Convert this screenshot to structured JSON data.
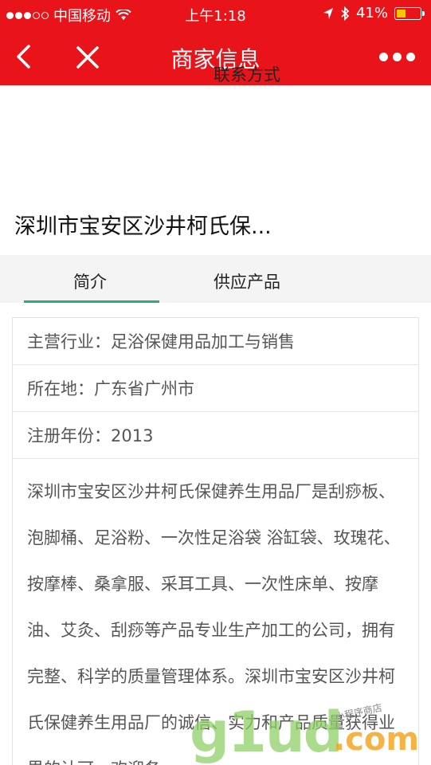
{
  "status": {
    "carrier": "中国移动",
    "time": "上午1:18",
    "battery": "41%",
    "battery_level": 0.41
  },
  "nav": {
    "title": "商家信息"
  },
  "merchant": {
    "name": "深圳市宝安区沙井柯氏保..."
  },
  "tabs": [
    {
      "label": "简介"
    },
    {
      "label": "供应产品"
    },
    {
      "label": "联系方式"
    }
  ],
  "info": {
    "industry": "主营行业：足浴保健用品加工与销售",
    "location": "所在地：广东省广州市",
    "reg_year": "注册年份：2013"
  },
  "description": "深圳市宝安区沙井柯氏保健养生用品厂是刮痧板、泡脚桶、足浴粉、一次性足浴袋 浴缸袋、玫瑰花、按摩棒、桑拿服、采耳工具、一次性床单、按摩油、艾灸、刮痧等产品专业生产加工的公司，拥有完整、科学的质量管理体系。深圳市宝安区沙井柯氏保健养生用品厂的诚信、实力和产品质量获得业界的认可。欢迎各",
  "watermark": {
    "main": "g1ud",
    "com": ".com",
    "sub": "小程序商店"
  }
}
